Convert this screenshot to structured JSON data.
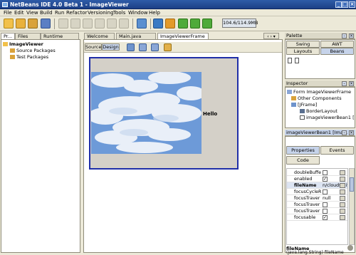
{
  "window": {
    "title": "NetBeans IDE 4.0 Beta 1 - ImageViewer"
  },
  "menu": [
    "File",
    "Edit",
    "View",
    "Build",
    "Run",
    "Refactor",
    "Versioning",
    "Tools",
    "Window",
    "Help"
  ],
  "toolbar": {
    "memory": "104.6/114.9MB"
  },
  "projects": {
    "tabs": [
      "Pr...",
      "Files",
      "Runtime"
    ],
    "tree": [
      {
        "label": "ImageViewer",
        "level": 0
      },
      {
        "label": "Source Packages",
        "level": 1
      },
      {
        "label": "Test Packages",
        "level": 1
      }
    ]
  },
  "editor": {
    "tabs": [
      "Welcome",
      "Main.java",
      "ImageViewerFrame *"
    ],
    "view_tabs": [
      "Source",
      "Design"
    ],
    "label_text": "Hello"
  },
  "palette": {
    "title": "Palette",
    "buttons": [
      "Swing",
      "AWT",
      "Layouts",
      "Beans"
    ]
  },
  "inspector": {
    "title": "Inspector",
    "tree": [
      {
        "label": "Form ImageViewerFrame",
        "level": 0
      },
      {
        "label": "Other Components",
        "level": 1
      },
      {
        "label": "[JFrame]",
        "level": 1
      },
      {
        "label": "BorderLayout",
        "level": 2
      },
      {
        "label": "imageViewerBean1 [Im",
        "level": 2
      }
    ]
  },
  "properties": {
    "title": "imageViewerBean1 [Ima...",
    "tabs": [
      "Properties",
      "Events",
      "Code"
    ],
    "rows": [
      {
        "name": "doubleBuffer",
        "value": "",
        "checkbox": true,
        "checked": false
      },
      {
        "name": "enabled",
        "value": "",
        "checkbox": true,
        "checked": true
      },
      {
        "name": "fileName",
        "value": "n/clouds.gif",
        "checkbox": false,
        "checked": false,
        "bold": true
      },
      {
        "name": "focusCycleR",
        "value": "",
        "checkbox": true,
        "checked": false
      },
      {
        "name": "focusTraver",
        "value": "null",
        "checkbox": false,
        "checked": false
      },
      {
        "name": "focusTraver",
        "value": "",
        "checkbox": true,
        "checked": false
      },
      {
        "name": "focusTraver",
        "value": "",
        "checkbox": true,
        "checked": false
      },
      {
        "name": "focusable",
        "value": "",
        "checkbox": true,
        "checked": true
      }
    ],
    "desc_title": "fileName",
    "desc_text": "(java.lang.String) fileName"
  }
}
